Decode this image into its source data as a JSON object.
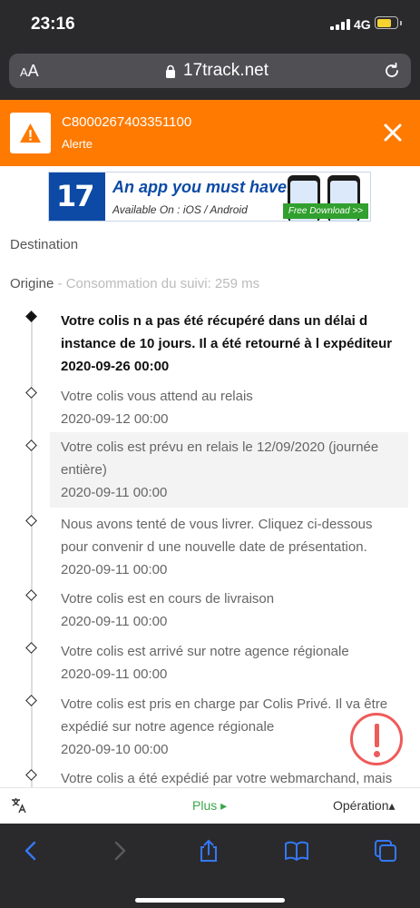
{
  "status_bar": {
    "time": "23:16",
    "network": "4G",
    "battery_level": 0.75,
    "colors": {
      "battery": "#f5d330"
    }
  },
  "browser": {
    "aa_label": "AA",
    "url": "17track.net",
    "icons": {
      "lock": "lock-icon",
      "reload": "reload-icon"
    }
  },
  "alert": {
    "code": "C8000267403351100",
    "label": "Alerte",
    "color": "#ff7a00",
    "icons": {
      "warning": "warning-icon",
      "close": "close-icon"
    }
  },
  "banner": {
    "logo": "17",
    "headline": "An app you must have!",
    "subline": "Available On : iOS / Android",
    "cta": "Free Download >>"
  },
  "meta": {
    "destination_label": "Destination",
    "origin_label": "Origine",
    "tracking_time": "- Consommation du suivi: 259 ms"
  },
  "events": [
    {
      "text": "Votre colis n a pas été récupéré dans un délai d instance de 10 jours. Il a été retourné à l expéditeur",
      "date": "2020-09-26 00:00"
    },
    {
      "text": "Votre colis vous attend au relais",
      "date": "2020-09-12 00:00"
    },
    {
      "text": "Votre colis est prévu en relais le 12/09/2020 (journée entière)",
      "date": "2020-09-11 00:00"
    },
    {
      "text": "Nous avons tenté de vous livrer. Cliquez ci-dessous pour convenir d une nouvelle date de présentation.",
      "date": "2020-09-11 00:00"
    },
    {
      "text": "Votre colis est en cours de livraison",
      "date": "2020-09-11 00:00"
    },
    {
      "text": "Votre colis est arrivé sur notre agence régionale",
      "date": "2020-09-11 00:00"
    },
    {
      "text": "Votre colis est pris en charge par Colis Privé. Il va être expédié sur notre agence régionale",
      "date": "2020-09-10 00:00"
    },
    {
      "text": "Votre colis a été expédié par votre webmarchand, mais",
      "date": ""
    }
  ],
  "page_bar": {
    "plus_label": "Plus ▸",
    "operation_label": "Opération▴",
    "colors": {
      "plus": "#3aa64a"
    }
  },
  "toolbar": {
    "icons": [
      "back-icon",
      "forward-icon",
      "share-icon",
      "bookmarks-icon",
      "tabs-icon"
    ],
    "accent": "#3478f6"
  }
}
